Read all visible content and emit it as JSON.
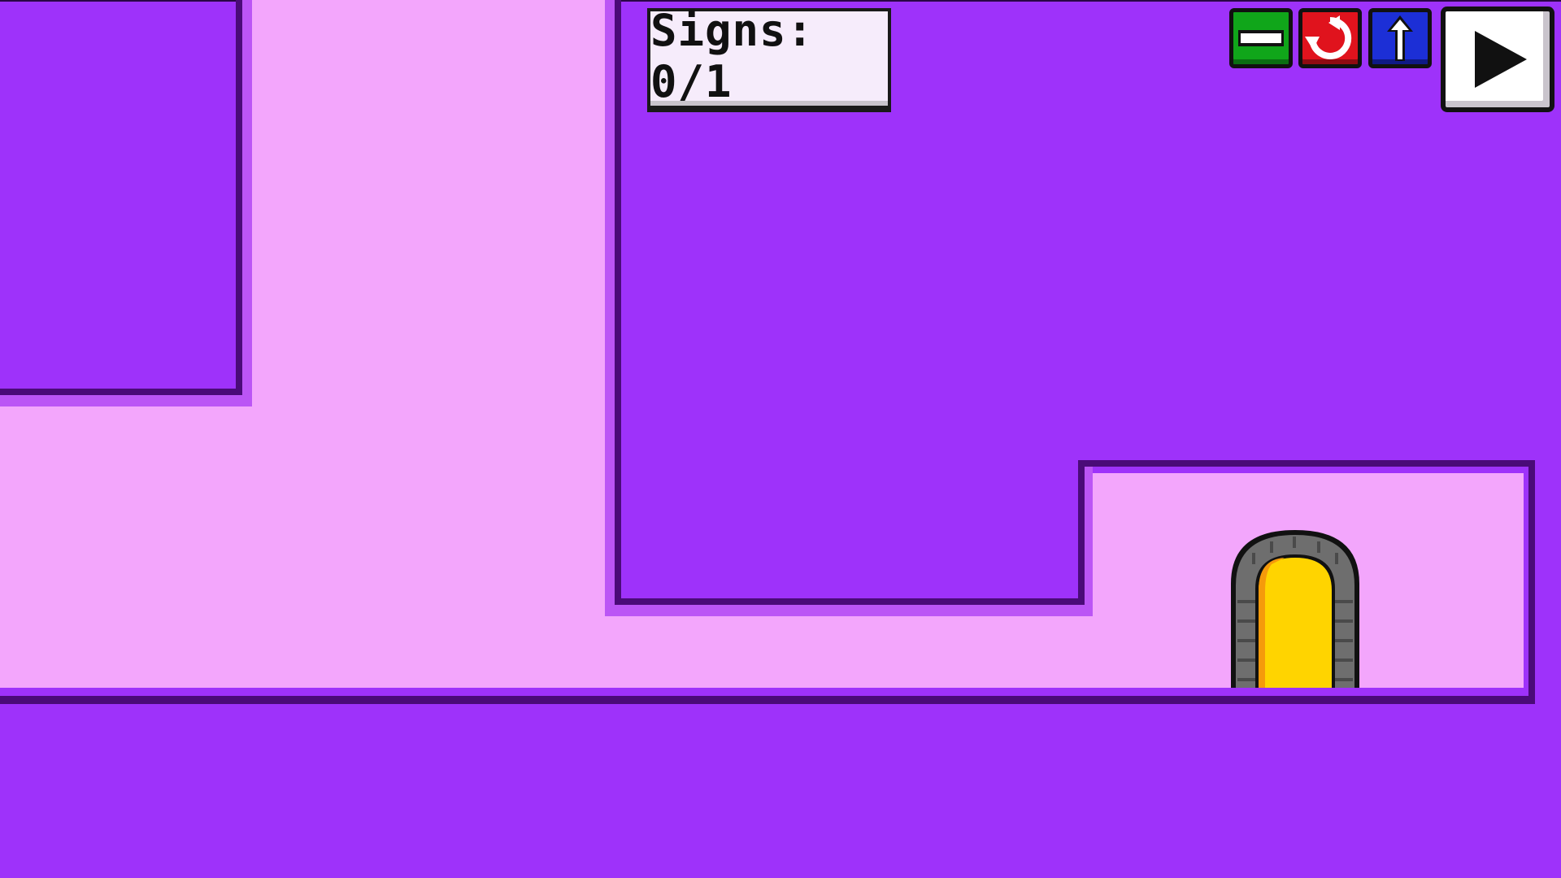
{
  "hud": {
    "signs_label": "Signs: 0/1",
    "buttons": [
      {
        "name": "minus-button",
        "icon": "minus-icon",
        "color": "#10a61a"
      },
      {
        "name": "restart-button",
        "icon": "restart-icon",
        "color": "#e0131d"
      },
      {
        "name": "jump-button",
        "icon": "up-arrow-icon",
        "color": "#1c2fd6"
      },
      {
        "name": "play-button",
        "icon": "play-icon",
        "color": "#ffffff"
      }
    ]
  },
  "level": {
    "background_color": "#9e32fa",
    "corridor_color": "#f3a6fc",
    "outline_color": "#4a0b78",
    "door": {
      "icon": "exit-door-icon",
      "fill_color": "#ffd400",
      "frame_color": "#6e6e6e"
    }
  }
}
